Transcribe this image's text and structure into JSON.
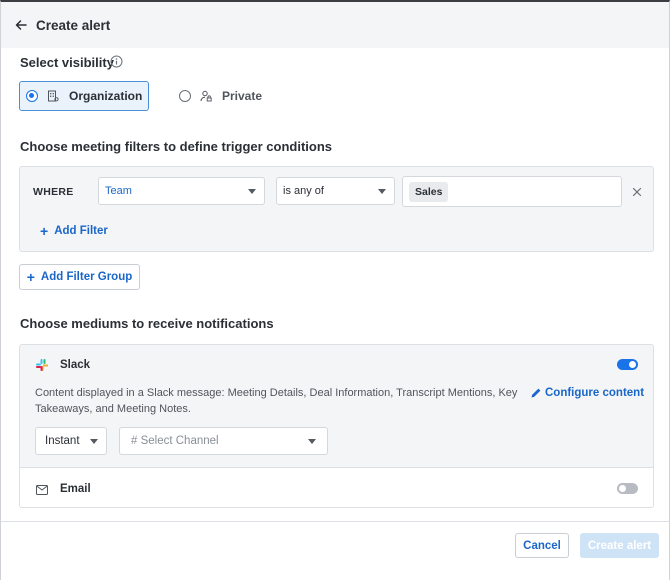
{
  "header": {
    "title": "Create alert"
  },
  "visibility": {
    "title": "Select visibility",
    "options": [
      {
        "label": "Organization",
        "selected": true
      },
      {
        "label": "Private",
        "selected": false
      }
    ]
  },
  "filters": {
    "title": "Choose meeting filters to define trigger conditions",
    "where_label": "WHERE",
    "field_value": "Team",
    "operator_value": "is any of",
    "selected_values": [
      "Sales"
    ],
    "add_filter_label": "Add Filter",
    "add_filter_group_label": "Add Filter Group"
  },
  "mediums": {
    "title": "Choose mediums to receive notifications",
    "slack": {
      "label": "Slack",
      "enabled": true,
      "description": "Content displayed in a Slack message: Meeting Details, Deal Information, Transcript Mentions, Key Takeaways, and Meeting Notes.",
      "configure_label": "Configure content",
      "frequency_value": "Instant",
      "channel_placeholder": "# Select Channel"
    },
    "email": {
      "label": "Email",
      "enabled": false
    }
  },
  "footer": {
    "cancel_label": "Cancel",
    "create_label": "Create alert"
  },
  "colors": {
    "accent": "#1a73e8",
    "link": "#1a66c9",
    "disabled_button": "#cfe3f7"
  }
}
